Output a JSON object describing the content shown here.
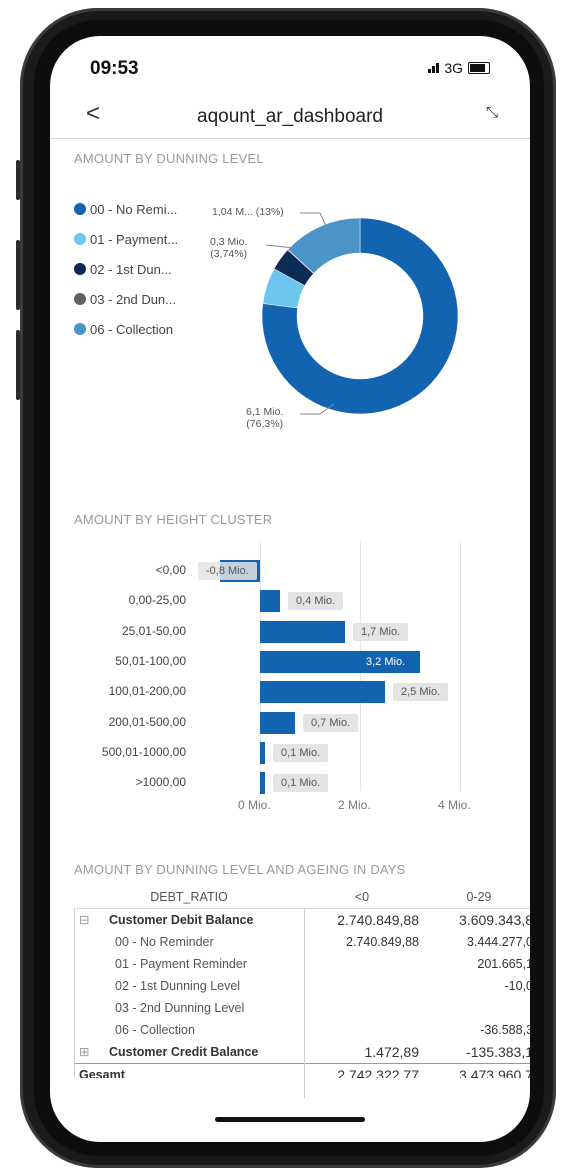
{
  "status": {
    "time": "09:53",
    "network": "3G"
  },
  "nav": {
    "back_glyph": "<",
    "title": "aqount_ar_dashboard",
    "collapse_glyph": "⤡"
  },
  "sections": {
    "dunning": "AMOUNT BY DUNNING LEVEL",
    "height": "AMOUNT BY HEIGHT CLUSTER",
    "table": "AMOUNT BY DUNNING LEVEL AND AGEING IN DAYS"
  },
  "colors": {
    "primary": "#1264b0",
    "light": "#6ec6ee",
    "navy": "#0d2b55",
    "gray": "#606060",
    "teal": "#4a94c8"
  },
  "chart_data": [
    {
      "type": "pie",
      "title": "AMOUNT BY DUNNING LEVEL",
      "legend": [
        "00 - No Remi...",
        "01 - Payment...",
        "02 - 1st Dun...",
        "03 - 2nd Dun...",
        "06 - Collection"
      ],
      "legend_colors": [
        "#1264b0",
        "#6ec6ee",
        "#0d2b55",
        "#606060",
        "#4a94c8"
      ],
      "values": [
        76.3,
        5.9,
        3.74,
        0.1,
        13.0
      ],
      "labels": [
        "6,1 Mio.\n(76,3%)",
        "0,3 Mio.\n(3,74%)",
        "1,04 M... (13%)"
      ]
    },
    {
      "type": "bar",
      "title": "AMOUNT BY HEIGHT CLUSTER",
      "categories": [
        "<0,00",
        "0,00-25,00",
        "25,01-50,00",
        "50,01-100,00",
        "100,01-200,00",
        "200,01-500,00",
        "500,01-1000,00",
        ">1000,00"
      ],
      "values": [
        -0.8,
        0.4,
        1.7,
        3.2,
        2.5,
        0.7,
        0.1,
        0.1
      ],
      "value_labels": [
        "-0,8 Mio.",
        "0,4 Mio.",
        "1,7 Mio.",
        "3,2 Mio.",
        "2,5 Mio.",
        "0,7 Mio.",
        "0,1 Mio.",
        "0,1 Mio."
      ],
      "xticks": [
        "0 Mio.",
        "2 Mio.",
        "4 Mio."
      ],
      "xlim": [
        -1,
        4
      ]
    }
  ],
  "table": {
    "headers": [
      "DEBT_RATIO",
      "<0",
      "0-29"
    ],
    "rows": [
      {
        "expand": "⊟",
        "label": "Customer Debit Balance",
        "c1": "2.740.849,88",
        "c2": "3.609.343,8",
        "bold": true
      },
      {
        "expand": "",
        "label": "00 - No Reminder",
        "c1": "2.740.849,88",
        "c2": "3.444.277,0",
        "bold": false
      },
      {
        "expand": "",
        "label": "01 - Payment Reminder",
        "c1": "",
        "c2": "201.665,1",
        "bold": false
      },
      {
        "expand": "",
        "label": "02 - 1st Dunning Level",
        "c1": "",
        "c2": "-10,0",
        "bold": false
      },
      {
        "expand": "",
        "label": "03 - 2nd Dunning Level",
        "c1": "",
        "c2": "",
        "bold": false
      },
      {
        "expand": "",
        "label": "06 - Collection",
        "c1": "",
        "c2": "-36.588,3",
        "bold": false
      },
      {
        "expand": "⊞",
        "label": "Customer Credit Balance",
        "c1": "1.472,89",
        "c2": "-135.383,1",
        "bold": true
      },
      {
        "expand": "",
        "label": "Gesamt",
        "c1": "2.742.322,77",
        "c2": "3.473.960,7",
        "bold": true
      }
    ]
  }
}
